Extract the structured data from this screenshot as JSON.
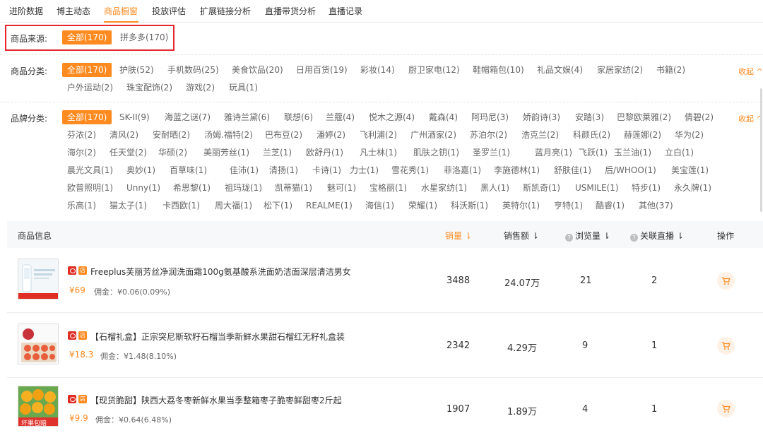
{
  "tabs": [
    "进阶数据",
    "博主动态",
    "商品橱窗",
    "投放评估",
    "扩展链接分析",
    "直播带货分析",
    "直播记录"
  ],
  "active_tab": "商品橱窗",
  "source": {
    "label": "商品来源:",
    "chips": [
      "全部(170)",
      "拼多多(170)"
    ]
  },
  "category": {
    "label": "商品分类:",
    "collapse": "收起 ^",
    "chips": [
      "全部(170)",
      "护肤(52)",
      "手机数码(25)",
      "美食饮品(20)",
      "日用百货(19)",
      "彩妆(14)",
      "厨卫家电(12)",
      "鞋帽箱包(10)",
      "礼品文娱(4)",
      "家居家纺(2)",
      "书籍(2)",
      "户外运动(2)",
      "珠宝配饰(2)",
      "游戏(2)",
      "玩具(1)"
    ]
  },
  "brand": {
    "label": "品牌分类:",
    "collapse": "收起 ^",
    "chips": [
      "全部(170)",
      "SK-II(9)",
      "海蓝之谜(7)",
      "雅诗兰黛(6)",
      "联想(6)",
      "兰蔻(4)",
      "悦木之源(4)",
      "戴森(4)",
      "阿玛尼(3)",
      "娇韵诗(3)",
      "安踏(3)",
      "巴黎欧莱雅(2)",
      "倩碧(2)",
      "芬浓(2)",
      "清风(2)",
      "安耐晒(2)",
      "汤姆.福特(2)",
      "巴布豆(2)",
      "潘婷(2)",
      "飞利浦(2)",
      "广州酒家(2)",
      "苏泊尔(2)",
      "浩克兰(2)",
      "科颜氏(2)",
      "赫莲娜(2)",
      "华为(2)",
      "海尔(2)",
      "任天堂(2)",
      "华硕(2)",
      "美丽芳丝(1)",
      "兰芝(1)",
      "欧舒丹(1)",
      "凡士林(1)",
      "肌肤之钥(1)",
      "圣罗兰(1)",
      "蓝月亮(1)",
      "飞跃(1)",
      "玉兰油(1)",
      "立白(1)",
      "晨光文具(1)",
      "奥妙(1)",
      "百草味(1)",
      "佳沛(1)",
      "清扬(1)",
      "卡诗(1)",
      "力士(1)",
      "雪花秀(1)",
      "菲洛嘉(1)",
      "李施德林(1)",
      "舒肤佳(1)",
      "后/WHOO(1)",
      "美宝莲(1)",
      "欧普照明(1)",
      "Unny(1)",
      "希思黎(1)",
      "祖玛珑(1)",
      "凯蒂猫(1)",
      "魅可(1)",
      "宝格丽(1)",
      "水星家纺(1)",
      "黑人(1)",
      "斯凯奇(1)",
      "USMILE(1)",
      "特步(1)",
      "永久牌(1)",
      "乐高(1)",
      "猫太子(1)",
      "卡西欧(1)",
      "周大福(1)",
      "松下(1)",
      "REALME(1)",
      "海信(1)",
      "荣耀(1)",
      "科沃斯(1)",
      "英特尔(1)",
      "亨特(1)",
      "酷睿(1)",
      "其他(37)"
    ]
  },
  "table": {
    "headers": {
      "info": "商品信息",
      "sales": "销量 ⇂",
      "revenue": "销售额 ⇂",
      "views": "浏览量 ⇂",
      "live": "关联直播 ⇂",
      "action": "操作"
    },
    "rows": [
      {
        "title": "Freeplus芙丽芳丝净润洗面霜100g氨基酸系洗面奶洁面深层清洁男女",
        "price": "¥69",
        "commission": "佣金：¥0.06(0.09%)",
        "sales": "3488",
        "revenue": "24.07万",
        "views": "21",
        "live": "2"
      },
      {
        "title": "【石榴礼盒】正宗突尼斯软籽石榴当季新鲜水果甜石榴红无籽礼盒装",
        "price": "¥18.3",
        "commission": "佣金：¥1.48(8.10%)",
        "sales": "2342",
        "revenue": "4.29万",
        "views": "9",
        "live": "1"
      },
      {
        "title": "【现货脆甜】陕西大荔冬枣新鲜水果当季整箱枣子脆枣鲜甜枣2斤起",
        "price": "¥9.9",
        "commission": "佣金：¥0.64(6.48%)",
        "sales": "1907",
        "revenue": "1.89万",
        "views": "4",
        "live": "1"
      }
    ]
  },
  "badges": {
    "platform": "拼",
    "store": "店"
  },
  "thumb3_text": "坏果包赔"
}
